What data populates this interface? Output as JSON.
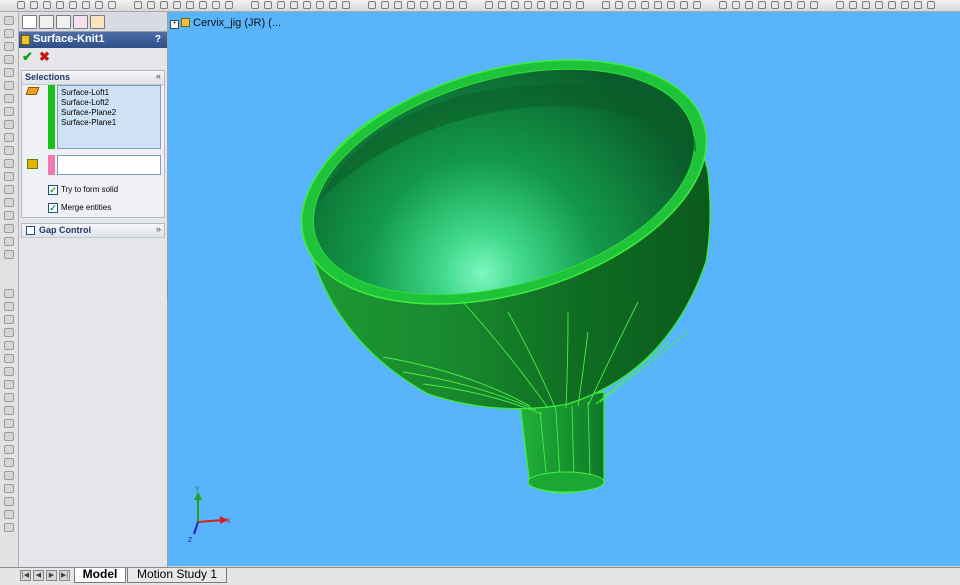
{
  "feature": {
    "title": "Surface-Knit1",
    "help": "?",
    "ok_symbol": "✔",
    "cancel_symbol": "✖"
  },
  "selections": {
    "header": "Selections",
    "chevron": "«",
    "items": [
      "Surface-Loft1",
      "Surface-Loft2",
      "Surface-Plane2",
      "Surface-Plane1"
    ],
    "try_form_solid": {
      "label": "Try to form solid",
      "checked": true
    },
    "merge_entities": {
      "label": "Merge entities",
      "checked": true
    }
  },
  "gap_control": {
    "label": "Gap Control",
    "chevron": "»",
    "checked": false
  },
  "tree": {
    "expander": "+",
    "root_label": "Cervix_jig (JR)  (..."
  },
  "triad": {
    "x": "X",
    "y": "Y",
    "z": "Z"
  },
  "tabs": {
    "model": "Model",
    "motion": "Motion Study 1"
  },
  "nav": {
    "first": "|◀",
    "prev": "◀",
    "next": "▶",
    "last": "▶|"
  },
  "colors": {
    "viewport_bg": "#59b5fb",
    "model_green": "#1a9a2a",
    "edge_green": "#38e838",
    "pm_title": "#34548e"
  }
}
